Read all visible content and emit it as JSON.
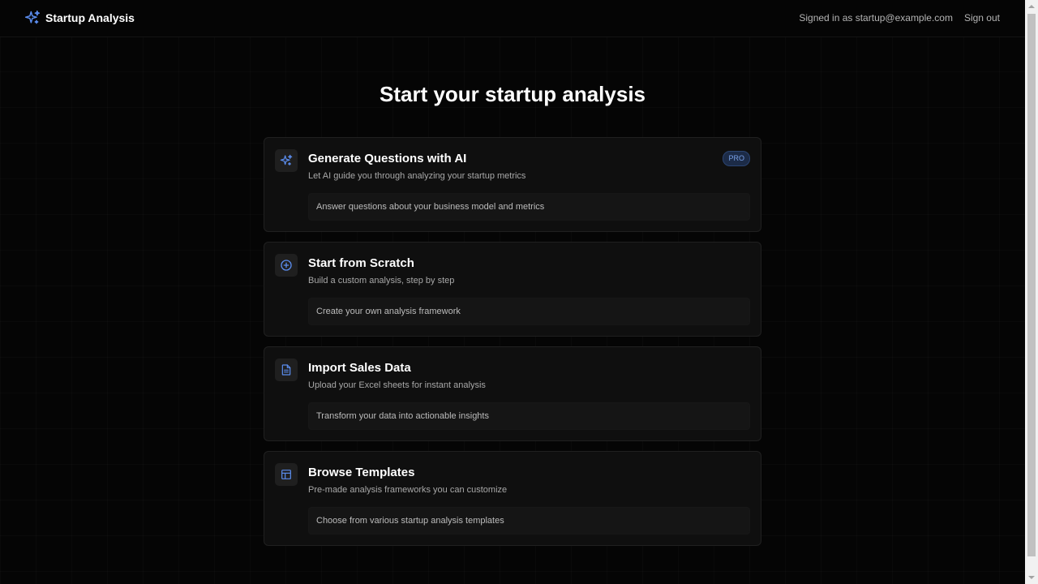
{
  "header": {
    "brand_title": "Startup Analysis",
    "signed_in_text": "Signed in as startup@example.com",
    "signout_label": "Sign out"
  },
  "main": {
    "title": "Start your startup analysis",
    "cards": [
      {
        "icon": "sparkles-icon",
        "title": "Generate Questions with AI",
        "subtitle": "Let AI guide you through analyzing your startup metrics",
        "detail": "Answer questions about your business model and metrics",
        "badge": "PRO"
      },
      {
        "icon": "plus-circle-icon",
        "title": "Start from Scratch",
        "subtitle": "Build a custom analysis, step by step",
        "detail": "Create your own analysis framework"
      },
      {
        "icon": "document-icon",
        "title": "Import Sales Data",
        "subtitle": "Upload your Excel sheets for instant analysis",
        "detail": "Transform your data into actionable insights"
      },
      {
        "icon": "layout-template-icon",
        "title": "Browse Templates",
        "subtitle": "Pre-made analysis frameworks you can customize",
        "detail": "Choose from various startup analysis templates"
      }
    ]
  },
  "colors": {
    "background": "#050505",
    "card": "#0f0f0f",
    "accent": "#5b8def",
    "badge_bg": "#1c2b47",
    "badge_text": "#7aa2e8"
  }
}
